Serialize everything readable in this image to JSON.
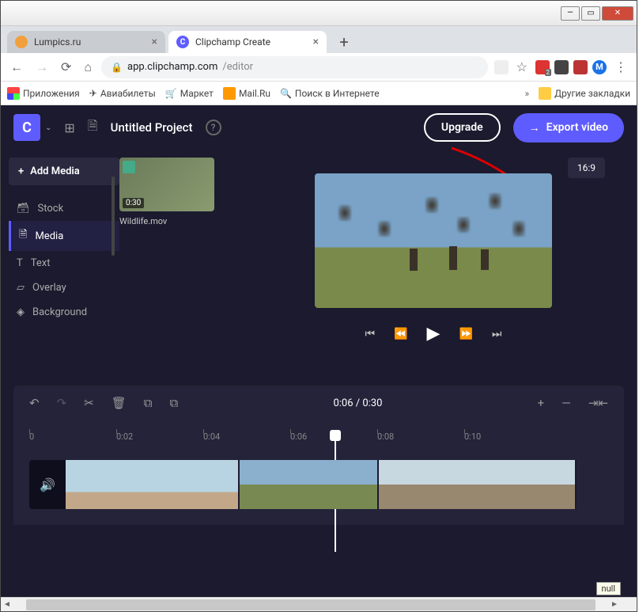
{
  "browser": {
    "tabs": [
      {
        "title": "Lumpics.ru"
      },
      {
        "title": "Clipchamp Create"
      }
    ],
    "url_host": "app.clipchamp.com",
    "url_path": "/editor",
    "bookmarks": {
      "apps": "Приложения",
      "avia": "Авиабилеты",
      "market": "Маркет",
      "mail": "Mail.Ru",
      "search": "Поиск в Интернете",
      "other": "Другие закладки"
    }
  },
  "app": {
    "logo": "C",
    "project_title": "Untitled Project",
    "upgrade": "Upgrade",
    "export": "Export video",
    "add_media": "Add Media",
    "aspect": "16:9",
    "sidebar": {
      "stock": "Stock",
      "media": "Media",
      "text": "Text",
      "overlay": "Overlay",
      "background": "Background"
    },
    "media_clip": {
      "duration": "0:30",
      "name": "Wildlife.mov"
    },
    "time_display": "0:06 / 0:30",
    "ruler": {
      "t0": "0",
      "t1": "0:02",
      "t2": "0:04",
      "t3": "0:06",
      "t4": "0:08",
      "t5": "0:10"
    },
    "tooltip": "null"
  }
}
